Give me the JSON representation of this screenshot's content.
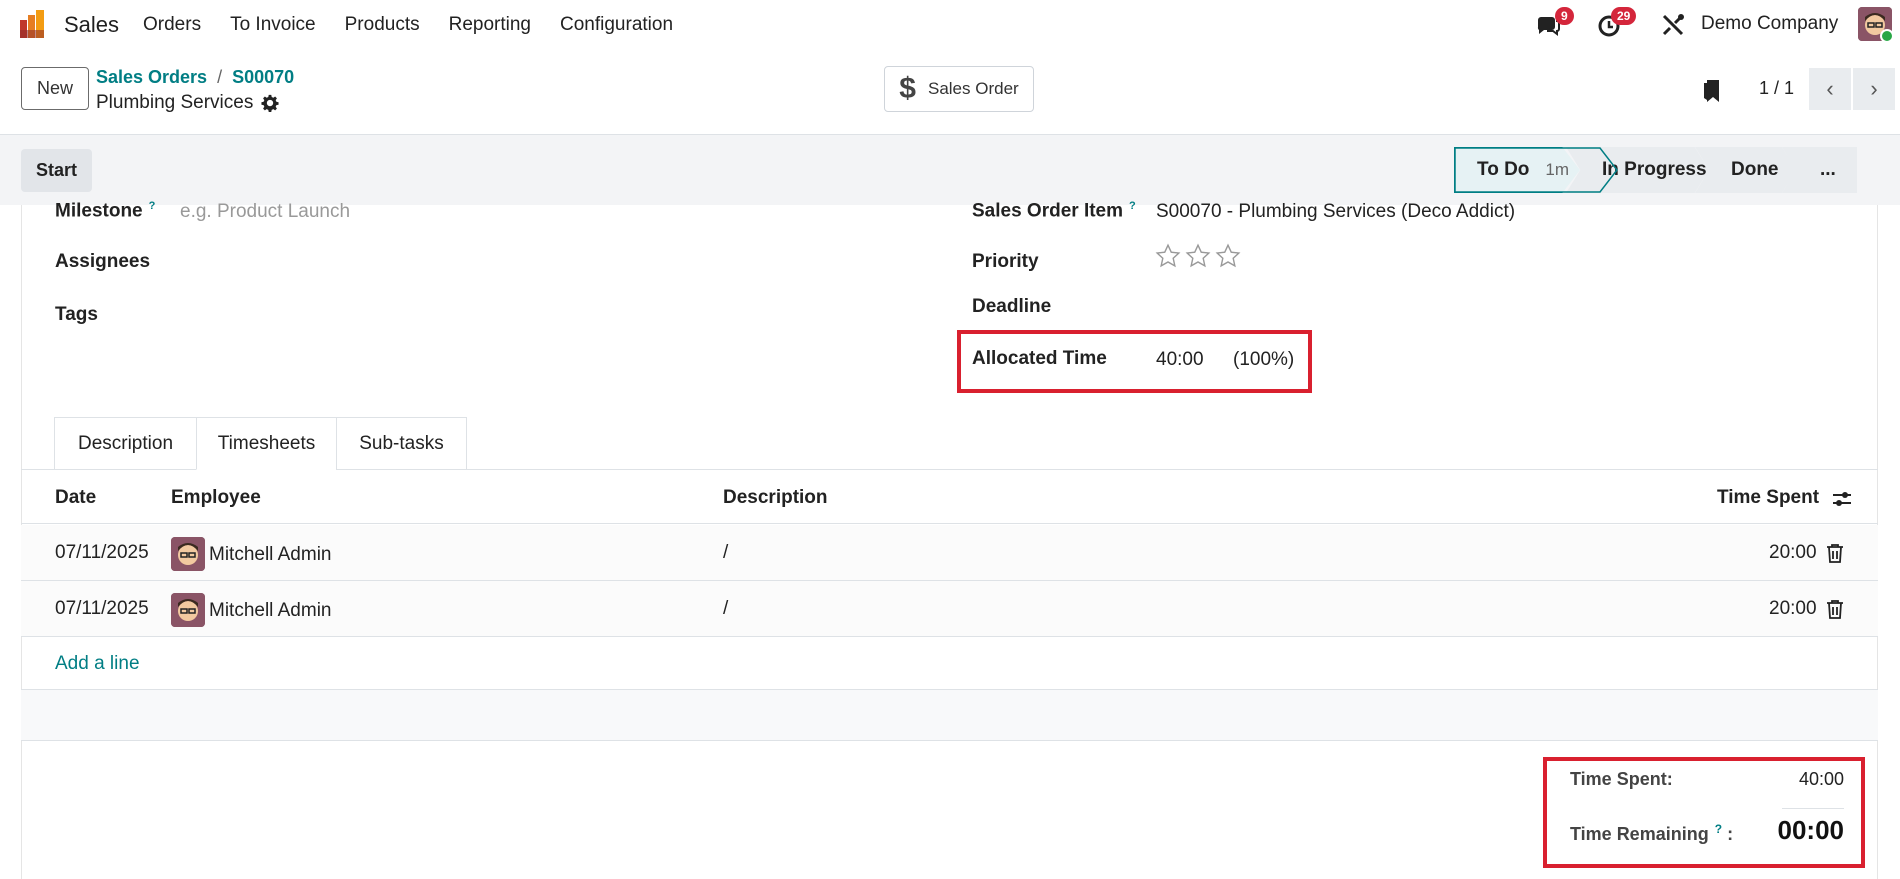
{
  "topbar": {
    "app_name": "Sales",
    "menu": [
      "Orders",
      "To Invoice",
      "Products",
      "Reporting",
      "Configuration"
    ],
    "messages_count": "9",
    "activities_count": "29",
    "company": "Demo Company"
  },
  "control": {
    "new_label": "New",
    "breadcrumb": [
      "Sales Orders",
      "S00070"
    ],
    "record_name": "Plumbing Services",
    "smart_button": "Sales Order",
    "pager": "1 / 1"
  },
  "statusbar": {
    "start_label": "Start",
    "stages": [
      {
        "label": "To Do",
        "duration": "1m",
        "active": true
      },
      {
        "label": "In Progress"
      },
      {
        "label": "Done"
      },
      {
        "label": "..."
      }
    ]
  },
  "form": {
    "milestone_label": "Milestone",
    "milestone_placeholder": "e.g. Product Launch",
    "assignees_label": "Assignees",
    "tags_label": "Tags",
    "so_item_label": "Sales Order Item",
    "so_item_value": "S00070 - Plumbing Services (Deco Addict)",
    "priority_label": "Priority",
    "priority_stars": 0,
    "deadline_label": "Deadline",
    "allocated_label": "Allocated Time",
    "allocated_value": "40:00",
    "allocated_pct": "(100%)"
  },
  "tabs": [
    "Description",
    "Timesheets",
    "Sub-tasks"
  ],
  "table": {
    "headers": [
      "Date",
      "Employee",
      "Description",
      "Time Spent"
    ],
    "rows": [
      {
        "date": "07/11/2025",
        "employee": "Mitchell Admin",
        "description": "/",
        "time": "20:00"
      },
      {
        "date": "07/11/2025",
        "employee": "Mitchell Admin",
        "description": "/",
        "time": "20:00"
      }
    ],
    "add_line": "Add a line"
  },
  "totals": {
    "spent_label": "Time Spent:",
    "spent_value": "40:00",
    "remaining_label": "Time Remaining",
    "remaining_help": "?",
    "remaining_colon": ":",
    "remaining_value": "00:00"
  },
  "colors": {
    "accent": "#017e84",
    "highlight": "#d9202f",
    "badge": "#d4263b"
  }
}
